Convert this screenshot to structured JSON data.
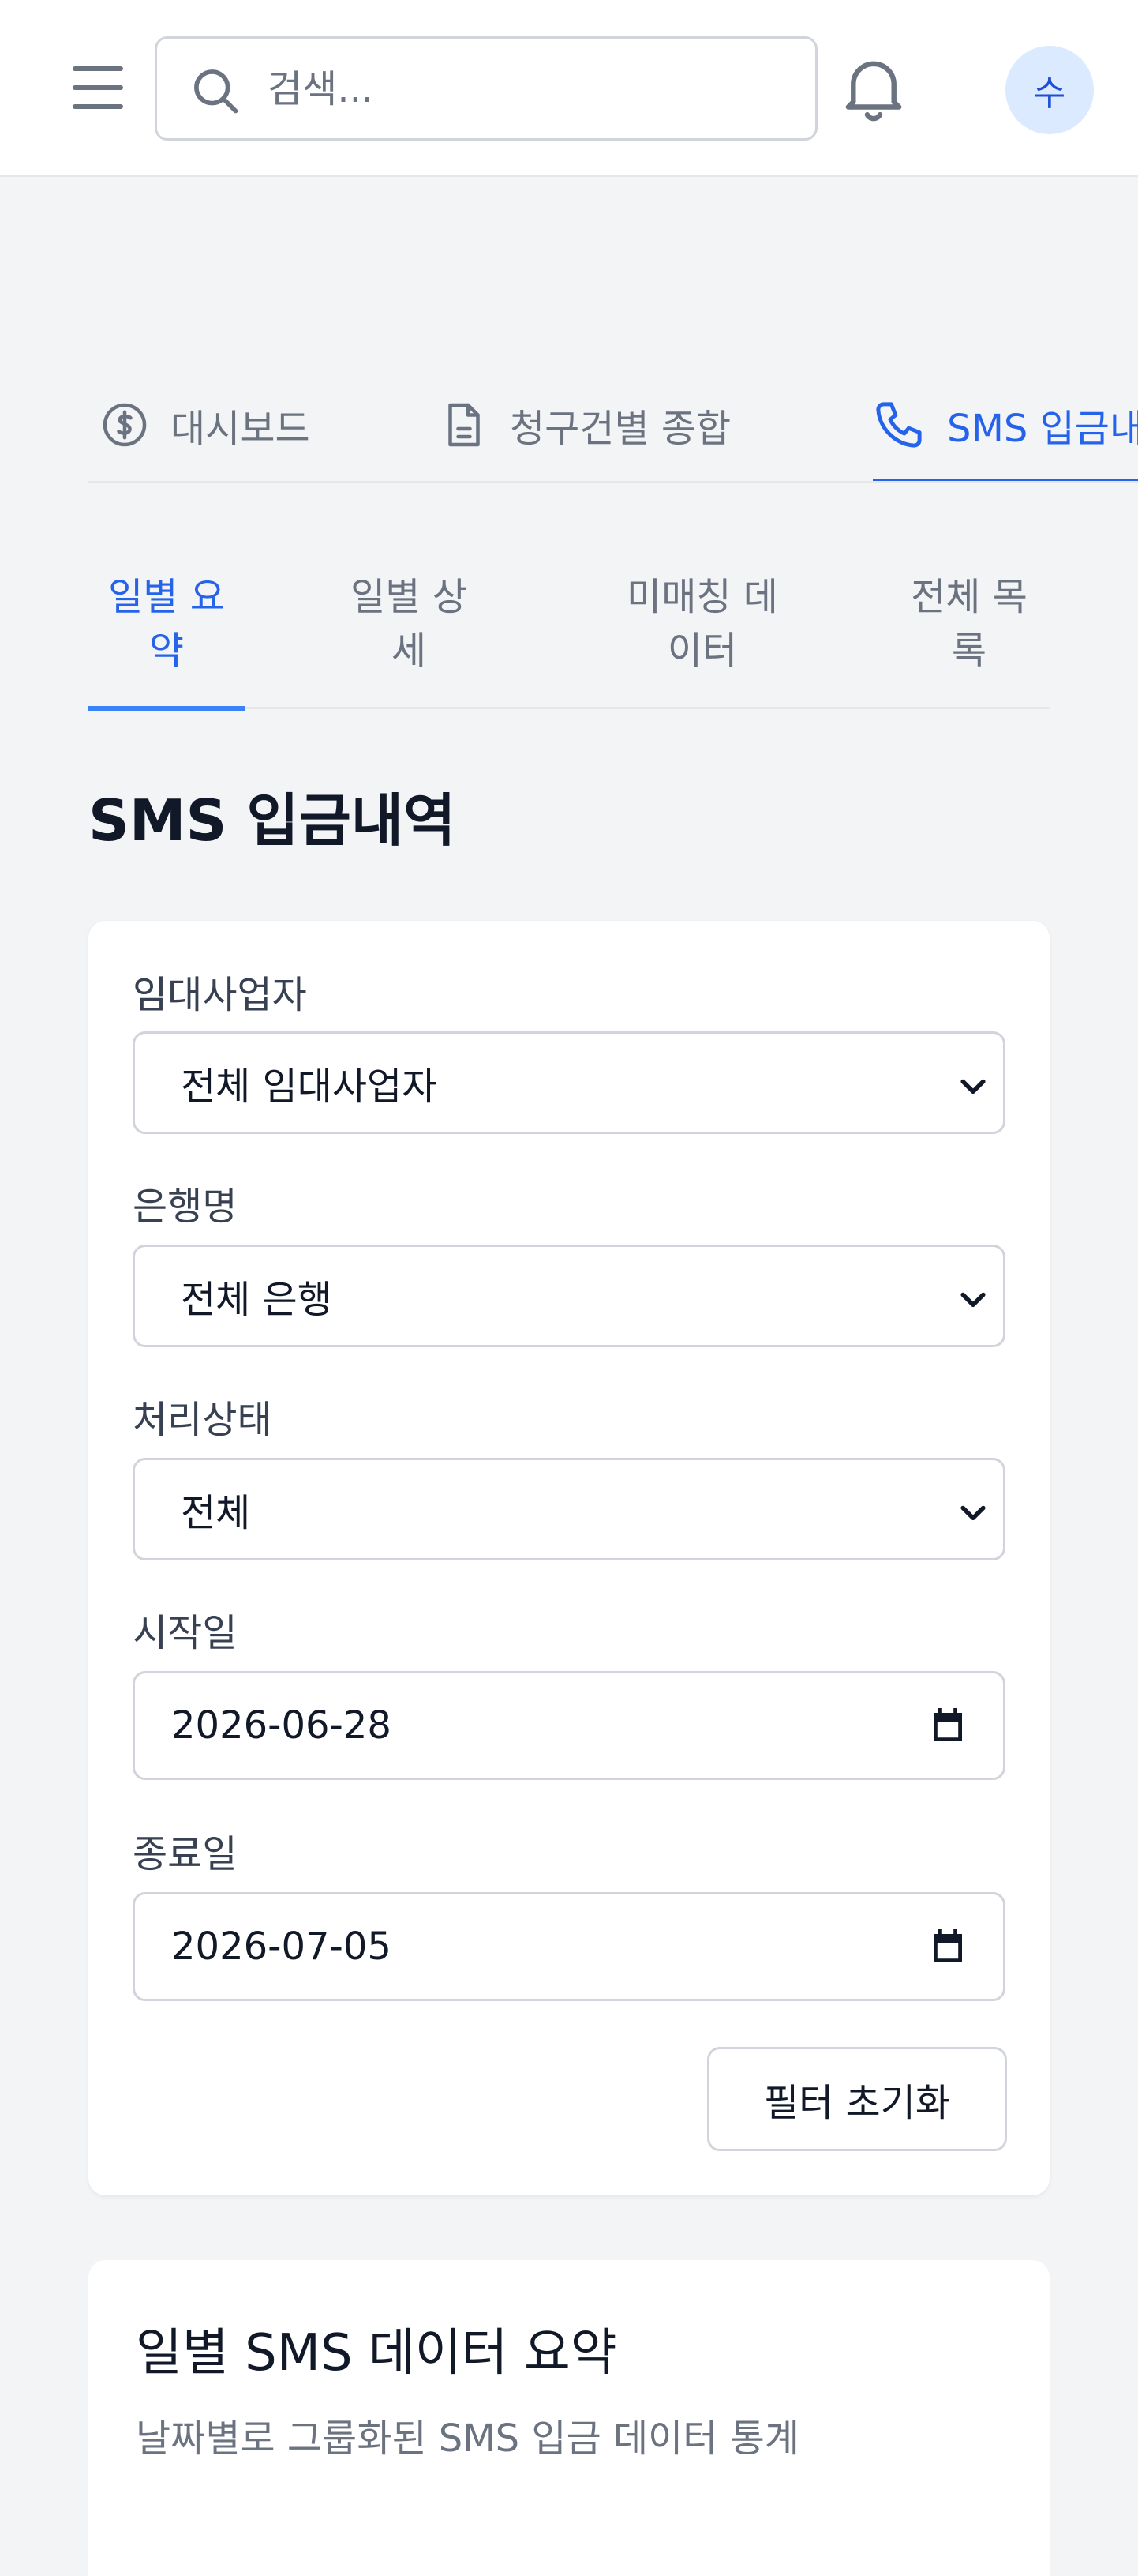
{
  "header": {
    "search_placeholder": "검색...",
    "avatar_initial": "수"
  },
  "main_tabs": [
    {
      "label": "대시보드",
      "icon": "dollar-circle-icon",
      "active": false
    },
    {
      "label": "청구건별 종합",
      "icon": "file-text-icon",
      "active": false
    },
    {
      "label": "SMS 입금내역",
      "icon": "phone-icon",
      "active": true
    }
  ],
  "sub_tabs": [
    {
      "label": "일별 요약",
      "active": true
    },
    {
      "label": "일별 상세",
      "active": false
    },
    {
      "label": "미매칭 데이터",
      "active": false
    },
    {
      "label": "전체 목록",
      "active": false
    }
  ],
  "page_title": "SMS 입금내역",
  "filters": {
    "lessor": {
      "label": "임대사업자",
      "value": "전체 임대사업자"
    },
    "bank": {
      "label": "은행명",
      "value": "전체 은행"
    },
    "status": {
      "label": "처리상태",
      "value": "전체"
    },
    "start_date": {
      "label": "시작일",
      "value": "2026-06-28"
    },
    "end_date": {
      "label": "종료일",
      "value": "2026-07-05"
    },
    "reset_label": "필터 초기화"
  },
  "summary": {
    "title": "일별 SMS 데이터 요약",
    "description": "날짜별로 그룹화된 SMS 입금 데이터 통계"
  },
  "colors": {
    "accent": "#2563eb",
    "text_muted": "#6b7280",
    "border": "#d1d5db",
    "background": "#f3f4f6"
  }
}
